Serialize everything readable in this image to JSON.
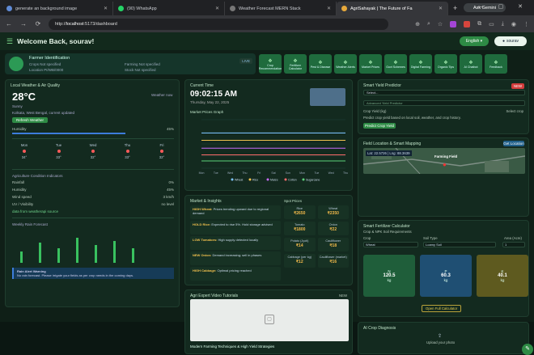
{
  "browser": {
    "tabs": [
      {
        "title": "generate an background image",
        "fav": "#5f8bd6"
      },
      {
        "title": "(90) WhatsApp",
        "fav": "#25d366"
      },
      {
        "title": "Weather Forecast MERN Stack",
        "fav": "#5a5a5a"
      },
      {
        "title": "AgriSahayak | The Future of Fa",
        "fav": "#e7a93b"
      }
    ],
    "new_tab": "+",
    "ask_button": "Ask Gemini",
    "url_prefix": "http://",
    "url_host": "localhost",
    "url_rest": ":5173/dashboard",
    "win_controls": "— ▢ ✕"
  },
  "header": {
    "title": "Welcome Back, sourav!",
    "lang": "English",
    "user": "sourav"
  },
  "farmer": {
    "name": "Farmer Identification",
    "field1": "Crops Not specified",
    "field2": "Location PI/WB/0000",
    "field3": "Farming Not specified",
    "field4": "Stock Not specified",
    "badge": "LIVE"
  },
  "quick_actions": [
    "Crop Recommendation",
    "Fertilizer Calculator",
    "Pest & Disease",
    "Weather Alerts",
    "Market Prices",
    "Govt Schemes",
    "Digital Farming",
    "Organic Tips",
    "AI Chatbot",
    "Feedback"
  ],
  "weather": {
    "title": "Local Weather & Air Quality",
    "temp": "28°C",
    "cond": "Sunny",
    "right_note": "Weather now",
    "loc": "Kolkata, West Bengal, current updated",
    "btn": "Refresh Weather",
    "humidity_label": "Humidity",
    "humidity_val": "45%",
    "forecast": [
      {
        "d": "Mon",
        "t": "34°"
      },
      {
        "d": "Tue",
        "t": "33°"
      },
      {
        "d": "Wed",
        "t": "32°"
      },
      {
        "d": "Thu",
        "t": "33°"
      },
      {
        "d": "Fri",
        "t": "32°"
      }
    ],
    "aq_title": "Agriculture Condition Indicators",
    "rows": [
      {
        "k": "Rainfall",
        "v": "0%"
      },
      {
        "k": "Humidity",
        "v": "45%"
      },
      {
        "k": "Wind speed",
        "v": "3 km/h"
      },
      {
        "k": "UV / Visibility",
        "v": "no level"
      }
    ],
    "source": "data from weatherapi source",
    "weekly_title": "Weekly Rain Forecast",
    "weekly_heights": [
      0.4,
      0.7,
      0.5,
      0.85,
      0.6,
      0.75,
      0.5
    ],
    "alert_title": "Rain Alert Warning",
    "alert_text": "No rain forecast. Please irrigate your fields as per crop needs in the coming days."
  },
  "clock": {
    "title": "Current Time",
    "time": "09:02:15 AM",
    "date": "Thursday, May 22, 2025"
  },
  "market_chart": {
    "title": "Market Prices Graph",
    "legend": [
      "Wheat",
      "Rice",
      "Maize",
      "Cotton",
      "Sugarcane"
    ]
  },
  "chart_data": {
    "type": "line",
    "title": "Market Prices Graph",
    "x": [
      "Mon",
      "Tue",
      "Wed",
      "Thu",
      "Fri",
      "Sat",
      "Sun",
      "Mon",
      "Tue",
      "Wed",
      "Thu"
    ],
    "ylim": [
      0,
      4000
    ],
    "series": [
      {
        "name": "Wheat",
        "values": [
          2900,
          2900,
          2900,
          2900,
          2900,
          2900,
          2900,
          2900,
          2900,
          2900,
          2900
        ],
        "color": "#7cc4ff"
      },
      {
        "name": "Rice",
        "values": [
          2300,
          2300,
          2300,
          2300,
          2300,
          2300,
          2300,
          2300,
          2300,
          2300,
          2300
        ],
        "color": "#f2c14e"
      },
      {
        "name": "Maize",
        "values": [
          1650,
          1650,
          1650,
          1650,
          1650,
          1650,
          1650,
          1650,
          1650,
          1650,
          1650
        ],
        "color": "#c86bfa"
      },
      {
        "name": "Cotton",
        "values": [
          1100,
          1100,
          1100,
          1100,
          1100,
          1100,
          1100,
          1100,
          1100,
          1100,
          1100
        ],
        "color": "#ff6b6b"
      },
      {
        "name": "Sugarcane",
        "values": [
          600,
          600,
          600,
          600,
          600,
          600,
          600,
          600,
          600,
          600,
          600
        ],
        "color": "#5bd17a"
      }
    ]
  },
  "insights": {
    "title": "Market & Insights",
    "items": [
      {
        "k": "HIGH Wheat:",
        "t": "Prices trending upward due to regional demand"
      },
      {
        "k": "HOLD Rice:",
        "t": "Expected to rise 5%. Hold storage advised"
      },
      {
        "k": "LOW Tomatoes:",
        "t": "High supply detected locally"
      },
      {
        "k": "NEW Onion:",
        "t": "Demand increasing; sell in phases"
      },
      {
        "k": "HIGH Cabbage:",
        "t": "Optimal pricing reached"
      }
    ],
    "price_title": "Spot Prices",
    "prices": [
      {
        "n": "Rice",
        "v": "₹2650"
      },
      {
        "n": "Wheat",
        "v": "₹2350"
      },
      {
        "n": "Tomato",
        "v": "₹1800"
      },
      {
        "n": "Onion",
        "v": "₹22"
      },
      {
        "n": "Potato (Jyoti)",
        "v": "₹14"
      },
      {
        "n": "Cauliflower",
        "v": "₹18"
      },
      {
        "n": "Cabbage (per kg)",
        "v": "₹12"
      },
      {
        "n": "Cauliflower (market)",
        "v": "₹16"
      }
    ]
  },
  "video": {
    "title": "Agri Expert Video Tutorials",
    "caption": "Modern Farming Techniques & High Yield Strategies",
    "badge": "NEW"
  },
  "crop_pred": {
    "title": "Smart Yield Predictor",
    "input": "Select...",
    "hint": "Advanced Yield Predictor",
    "stat_label": "Crop Yield (kg)",
    "stat_val": "Select crop",
    "desc": "Predict crop yield based on local soil, weather, and crop history.",
    "btn": "Predict Crop Yield",
    "badge": "NEW"
  },
  "mapping": {
    "title": "Field Location & Smart Mapping",
    "btn": "Get Location",
    "coords": "Lat: 22.5726 | Lng: 88.3639",
    "pin": "Farming Field"
  },
  "soil": {
    "title": "Smart Fertilizer Calculator",
    "sub": "Crop & NPK Soil Requirements",
    "crop_label": "Crop",
    "crop_val": "Wheat",
    "soil_label": "Soil Type",
    "soil_val": "Loamy Soil",
    "area_label": "Area (Acre)",
    "area_val": "1",
    "npk": [
      {
        "k": "N",
        "v": "120.5",
        "u": "kg",
        "bg": "#1f5e3a"
      },
      {
        "k": "P",
        "v": "60.3",
        "u": "kg",
        "bg": "#1f4f73"
      },
      {
        "k": "K",
        "v": "40.1",
        "u": "kg",
        "bg": "#5e5a1f"
      }
    ],
    "btn": "Open Full Calculator"
  },
  "disease": {
    "title": "AI Crop Diagnosis",
    "upload": "Upload your photo"
  }
}
